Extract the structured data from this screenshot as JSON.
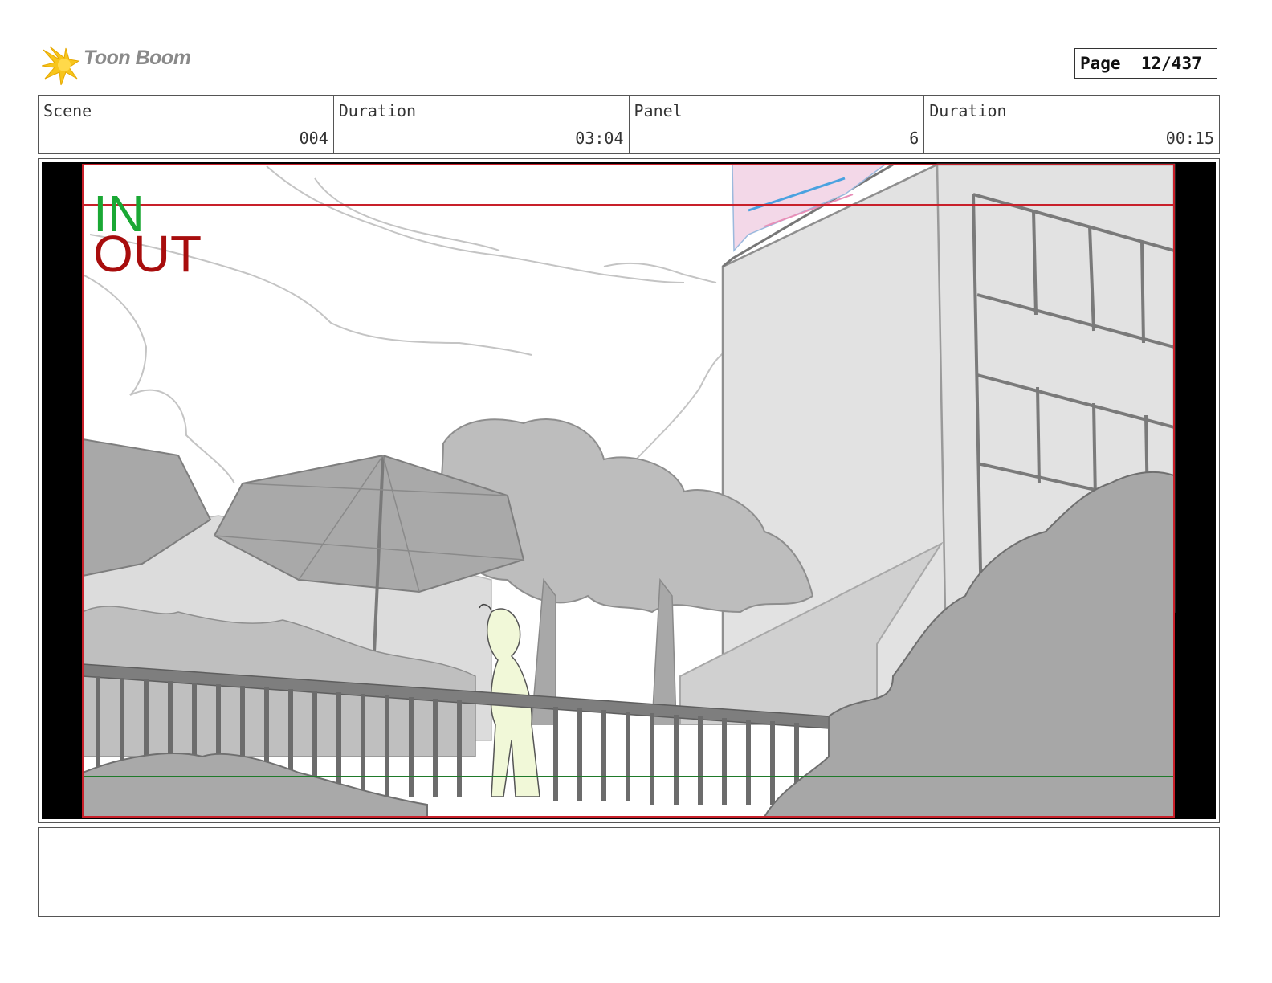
{
  "header": {
    "logo_text": "Toon Boom",
    "page_label": "Page",
    "page_number": "12/437"
  },
  "info": {
    "scene_label": "Scene",
    "scene_value": "004",
    "scene_duration_label": "Duration",
    "scene_duration_value": "03:04",
    "panel_label": "Panel",
    "panel_value": "6",
    "panel_duration_label": "Duration",
    "panel_duration_value": "00:15"
  },
  "panel": {
    "in_marker": "IN",
    "out_marker": "OUT",
    "in_color": "#1aa834",
    "out_color": "#a80d0d"
  },
  "notes": {
    "text": ""
  }
}
